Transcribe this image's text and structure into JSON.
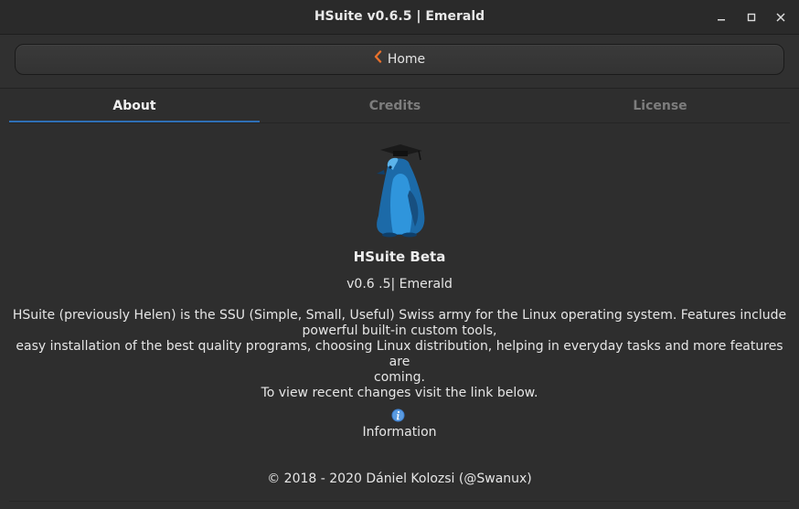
{
  "window": {
    "title": "HSuite v0.6.5 | Emerald",
    "minimize_icon": "minimize-icon",
    "maximize_icon": "maximize-icon",
    "close_icon": "close-icon"
  },
  "header": {
    "home_label": "Home",
    "home_icon": "chevron-left-icon"
  },
  "tabs": [
    {
      "label": "About",
      "active": true
    },
    {
      "label": "Credits",
      "active": false
    },
    {
      "label": "License",
      "active": false
    }
  ],
  "about": {
    "logo_icon": "penguin-graduate-logo",
    "app_name": "HSuite Beta",
    "version": "v0.6 .5| Emerald",
    "description": [
      "HSuite (previously Helen) is the SSU (Simple, Small, Useful) Swiss army for the Linux operating system. Features include",
      "powerful built-in custom tools,",
      "easy installation of the best quality programs, choosing Linux distribution, helping in everyday tasks and more features are",
      "coming.",
      "To view recent changes visit the link below."
    ],
    "info_icon": "info-icon",
    "info_link": "Information",
    "copyright": "© 2018 - 2020 Dániel Kolozsi (@Swanux)"
  },
  "colors": {
    "accent": "#2f6fb5",
    "chevron": "#e8712c",
    "background": "#2e2e2e"
  }
}
